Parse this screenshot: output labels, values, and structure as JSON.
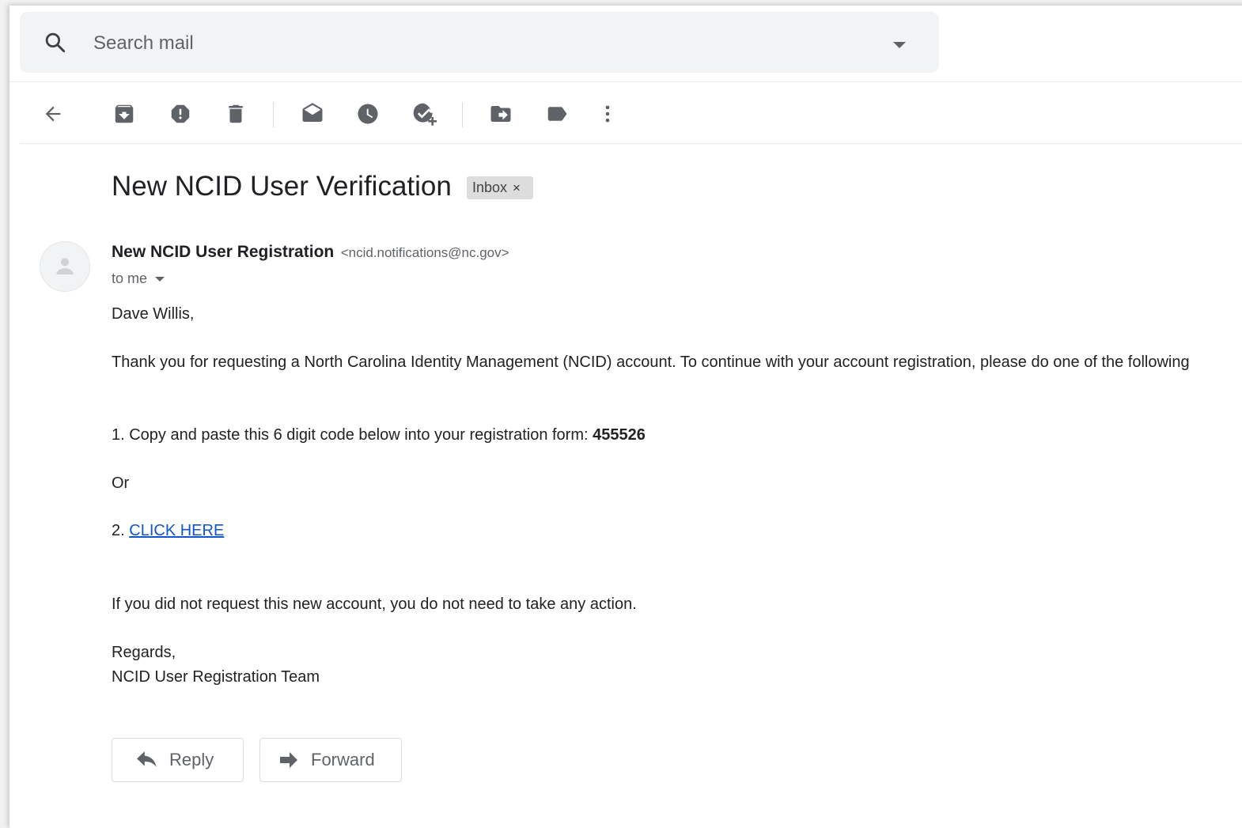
{
  "search": {
    "placeholder": "Search mail"
  },
  "toolbar": {
    "back": "arrow-back-icon",
    "archive": "archive-icon",
    "report_spam": "report-spam-icon",
    "delete": "delete-icon",
    "mark_unread": "mark-unread-icon",
    "snooze": "snooze-icon",
    "add_to_tasks": "add-to-tasks-icon",
    "move_to": "move-to-icon",
    "labels": "label-icon",
    "more": "more-vert-icon"
  },
  "message": {
    "subject": "New NCID User Verification",
    "label_badge": "Inbox",
    "label_remove": "×",
    "sender_name": "New NCID User Registration",
    "sender_email": "<ncid.notifications@nc.gov>",
    "recipient": "to me",
    "body": {
      "greeting": "Dave Willis,",
      "intro": "Thank you for requesting a North Carolina Identity Management (NCID) account. To continue with your account registration, please do one of the following",
      "option1_text": "1. Copy and paste this 6 digit code below into your registration form:",
      "code": "455526",
      "or": "Or",
      "option2_prefix": "2.",
      "option2_link": "CLICK HERE",
      "disclaimer": "If you did not request this new account, you do not need to take any action.",
      "closing": "Regards,",
      "signature": "NCID User Registration Team"
    }
  },
  "actions": {
    "reply": "Reply",
    "forward": "Forward"
  },
  "colors": {
    "link": "#1155cc",
    "icon": "#5f6368",
    "search_bg": "#f1f3f4"
  }
}
